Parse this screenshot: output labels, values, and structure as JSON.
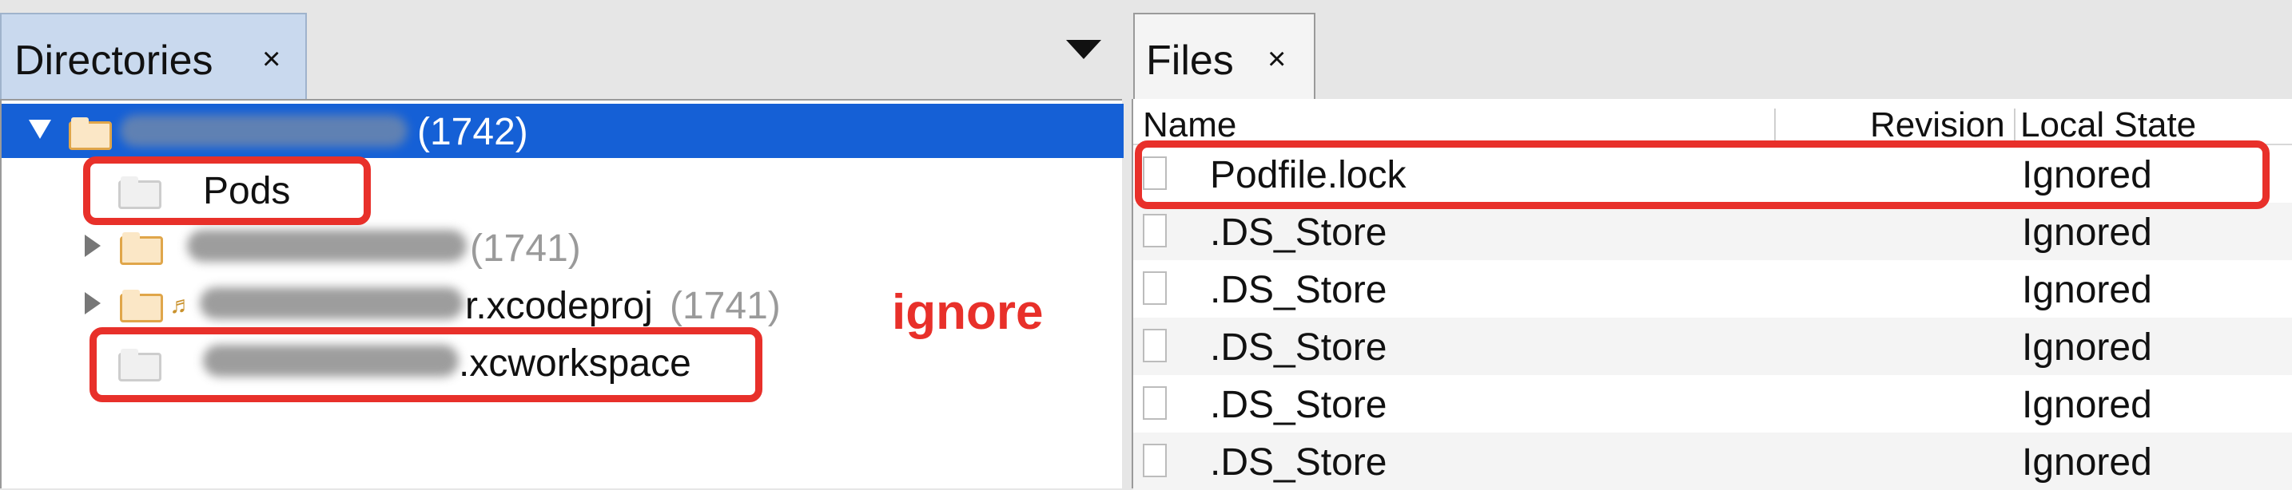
{
  "directories": {
    "tab_label": "Directories",
    "close_glyph": "×",
    "dropdown_icon": "triangle-down-icon",
    "root": {
      "label": "(1742)"
    },
    "items": [
      {
        "label": "Pods",
        "count": ""
      },
      {
        "label": "",
        "count": "(1741)"
      },
      {
        "label": "r.xcodeproj",
        "count": "(1741)"
      },
      {
        "label": ".xcworkspace",
        "count": ""
      }
    ],
    "annotation": "ignore"
  },
  "files": {
    "tab_label": "Files",
    "close_glyph": "×",
    "columns": [
      "Name",
      "Revision",
      "Local State"
    ],
    "rows": [
      {
        "name": "Podfile.lock",
        "state": "Ignored"
      },
      {
        "name": ".DS_Store",
        "state": "Ignored"
      },
      {
        "name": ".DS_Store",
        "state": "Ignored"
      },
      {
        "name": ".DS_Store",
        "state": "Ignored"
      },
      {
        "name": ".DS_Store",
        "state": "Ignored"
      },
      {
        "name": ".DS_Store",
        "state": "Ignored"
      }
    ]
  },
  "colors": {
    "selection": "#1560d6",
    "annotation": "#e8302a",
    "tab_active": "#c9d9ee"
  }
}
